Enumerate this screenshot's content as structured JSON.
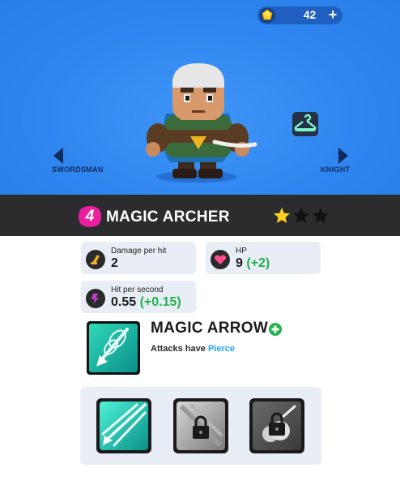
{
  "currency": {
    "amount": "42",
    "icon": "gem-icon",
    "add_label": "+"
  },
  "nav": {
    "left_label": "SWORDSMAN",
    "right_label": "KNIGHT"
  },
  "character": {
    "level": "4",
    "name": "MAGIC ARCHER",
    "stars_filled": 1,
    "stars_total": 3
  },
  "stats": {
    "damage": {
      "label": "Damage per hit",
      "value": "2"
    },
    "hp": {
      "label": "HP",
      "value": "9",
      "bonus": "(+2)"
    },
    "hit_rate": {
      "label": "Hit per second",
      "value": "0.55",
      "bonus": "(+0.15)"
    }
  },
  "ability": {
    "name": "MAGIC ARROW",
    "desc_prefix": "Attacks have ",
    "desc_keyword": "Pierce"
  },
  "upgrades": [
    {
      "name": "triple-arrow",
      "locked": false
    },
    {
      "name": "arrow-rain",
      "locked": true
    },
    {
      "name": "smoke-shot",
      "locked": true
    }
  ],
  "colors": {
    "sky": "#2f86f0",
    "bar": "#2c2c2e",
    "badge": "#e91fa0",
    "bonus": "#22b14c",
    "keyword": "#1fa3ff",
    "star": "#ffd21f"
  }
}
